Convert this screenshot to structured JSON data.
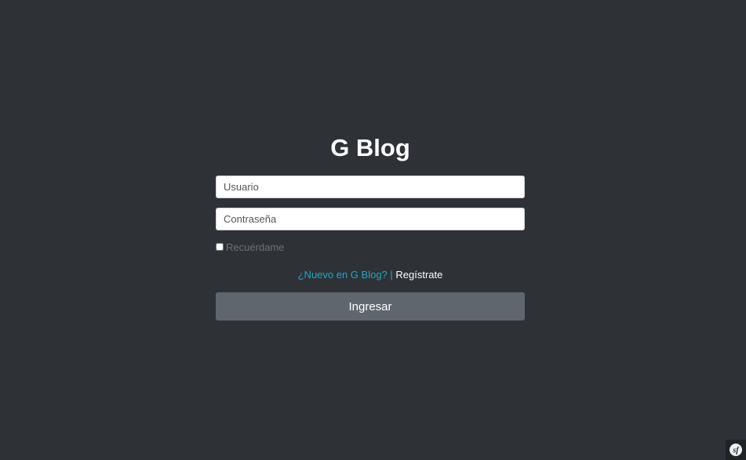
{
  "app": {
    "title": "G Blog"
  },
  "form": {
    "username_placeholder": "Usuario",
    "password_placeholder": "Contraseña",
    "remember_label": "Recuérdame",
    "new_user_text": "¿Nuevo en G Blog? |",
    "register_label": "Regístrate",
    "submit_label": "Ingresar"
  },
  "toolbar": {
    "icon": "symfony-icon"
  },
  "colors": {
    "background": "#2e3236",
    "accent": "#1fa6c7",
    "button": "#5f666d"
  }
}
